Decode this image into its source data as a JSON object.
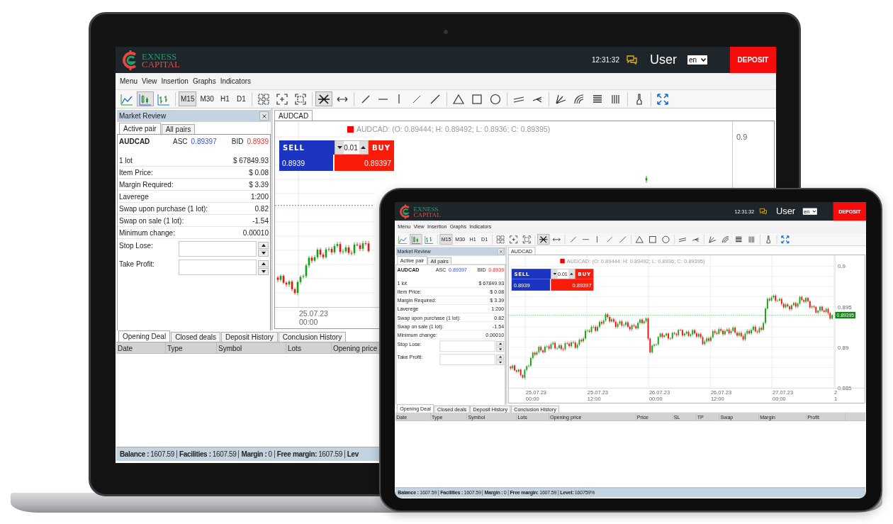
{
  "laptop_screen": {
    "header": {
      "logo": {
        "line_1": "EXNESS",
        "line_2": "CAPITAL"
      },
      "time": "12:31:32",
      "user": "User",
      "language": "en",
      "deposit_button": "DEPOSIT"
    },
    "menu": [
      "Menu",
      "View",
      "Insertion",
      "Graphs",
      "Indicators"
    ],
    "toolbar": {
      "chart_types": [
        {
          "kind": "line-chart",
          "selected": false
        },
        {
          "kind": "candlestick-chart",
          "selected": true
        },
        {
          "kind": "bar-chart",
          "selected": false
        }
      ],
      "timeframes": [
        {
          "label": "M15",
          "selected": true
        },
        {
          "label": "M30",
          "selected": false
        },
        {
          "label": "H1",
          "selected": false
        },
        {
          "label": "D1",
          "selected": false
        }
      ],
      "tool_groups": [
        {
          "tools": [
            {
              "kind": "grid-zoom",
              "selected": false
            },
            {
              "kind": "zoom-in",
              "selected": false
            },
            {
              "kind": "zoom-fit",
              "selected": false
            }
          ]
        },
        {
          "tools": [
            {
              "kind": "crosshair",
              "selected": true
            },
            {
              "kind": "horizontal-arrow",
              "selected": false
            }
          ]
        },
        {
          "tools": [
            {
              "kind": "diagonal-line",
              "selected": false
            },
            {
              "kind": "horizontal-line",
              "selected": false
            },
            {
              "kind": "vertical-line",
              "selected": false
            },
            {
              "kind": "diagonal-ray",
              "selected": false
            },
            {
              "kind": "diagonal-segment",
              "selected": false
            }
          ]
        },
        {
          "tools": [
            {
              "kind": "triangle",
              "selected": false
            },
            {
              "kind": "rectangle",
              "selected": false
            },
            {
              "kind": "circle",
              "selected": false
            }
          ]
        },
        {
          "tools": [
            {
              "kind": "parallel-lines",
              "selected": false
            },
            {
              "kind": "pitchfork",
              "selected": false
            }
          ]
        },
        {
          "tools": [
            {
              "kind": "fan-lines",
              "selected": false
            },
            {
              "kind": "arcs",
              "selected": false
            },
            {
              "kind": "horizontal-bars",
              "selected": false
            },
            {
              "kind": "vertical-bars",
              "selected": false
            }
          ]
        },
        {
          "tools": [
            {
              "kind": "brush",
              "selected": false
            }
          ]
        },
        {
          "tools": [
            {
              "kind": "expand",
              "selected": false
            }
          ]
        }
      ]
    },
    "market_review": {
      "title": "Market Review",
      "tabs": [
        {
          "label": "Active pair",
          "selected": true
        },
        {
          "label": "All pairs",
          "selected": false
        }
      ],
      "pair": {
        "symbol": "AUDCAD",
        "ask_label": "ASC",
        "ask": "0.89397",
        "bid_label": "BID",
        "bid": "0.8939"
      },
      "rows": [
        {
          "label": "1 lot",
          "value": "$ 67849.93"
        },
        {
          "label": "Item Price:",
          "value": "$ 0.08"
        },
        {
          "label": "Margin Required:",
          "value": "$ 3.39"
        },
        {
          "label": "Laverege",
          "value": "1:200"
        },
        {
          "label": "Swap upon purchase (1 lot):",
          "value": "0.82"
        },
        {
          "label": "Swap on sale (1 lot):",
          "value": "-1.54"
        },
        {
          "label": "Minimum change:",
          "value": "0.00010"
        }
      ],
      "fields": [
        {
          "label": "Stop Lose:"
        },
        {
          "label": "Take Profit:"
        }
      ]
    },
    "chart": {
      "tab": "AUDCAD",
      "title": "AUDCAD: (O: 0.89444; H: 0.89492; L: 0.8936; C: 0.89395)",
      "trade": {
        "sell_label": "SELL",
        "amount": "0.01",
        "buy_label": "BUY",
        "sell_price": "0.8939",
        "buy_price": "0.89397"
      },
      "y_ticks": [
        "0.9"
      ],
      "x_labels": [
        {
          "date": "25.07.23",
          "time": "00:00"
        }
      ]
    },
    "bottom": {
      "tabs": [
        {
          "label": "Opening Deal",
          "selected": true
        },
        {
          "label": "Closed deals",
          "selected": false
        },
        {
          "label": "Deposit History",
          "selected": false
        },
        {
          "label": "Conclusion History",
          "selected": false
        }
      ],
      "columns": [
        "Date",
        "Type",
        "Symbol",
        "Lots",
        "Opening price"
      ]
    },
    "status_bar": [
      {
        "label": "Balance :",
        "value": "1607.59"
      },
      {
        "label": "Facilities :",
        "value": "1607.59"
      },
      {
        "label": "Margin :",
        "value": "0"
      },
      {
        "label": "Free margin:",
        "value": "1607.59"
      },
      {
        "label": "Lev"
      }
    ]
  },
  "tablet_screen": {
    "header": {
      "logo": {
        "line_1": "EXNESS",
        "line_2": "CAPITAL"
      },
      "time": "12:31:32",
      "user": "User",
      "language": "en",
      "deposit_button": "DEPOSIT"
    },
    "menu": [
      "Menu",
      "View",
      "Insertion",
      "Graphs",
      "Indicators"
    ],
    "toolbar": {
      "chart_types": [
        {
          "kind": "line-chart",
          "selected": false
        },
        {
          "kind": "candlestick-chart",
          "selected": true
        },
        {
          "kind": "bar-chart",
          "selected": false
        }
      ],
      "timeframes": [
        {
          "label": "M15",
          "selected": true
        },
        {
          "label": "M30",
          "selected": false
        },
        {
          "label": "H1",
          "selected": false
        },
        {
          "label": "D1",
          "selected": false
        }
      ],
      "tool_groups": [
        {
          "tools": [
            {
              "kind": "grid-zoom",
              "selected": false
            },
            {
              "kind": "zoom-in",
              "selected": false
            },
            {
              "kind": "zoom-fit",
              "selected": false
            }
          ]
        },
        {
          "tools": [
            {
              "kind": "crosshair",
              "selected": true
            },
            {
              "kind": "horizontal-arrow",
              "selected": false
            }
          ]
        },
        {
          "tools": [
            {
              "kind": "diagonal-line",
              "selected": false
            },
            {
              "kind": "horizontal-line",
              "selected": false
            },
            {
              "kind": "vertical-line",
              "selected": false
            },
            {
              "kind": "diagonal-ray",
              "selected": false
            },
            {
              "kind": "diagonal-segment",
              "selected": false
            }
          ]
        },
        {
          "tools": [
            {
              "kind": "triangle",
              "selected": false
            },
            {
              "kind": "rectangle",
              "selected": false
            },
            {
              "kind": "circle",
              "selected": false
            }
          ]
        },
        {
          "tools": [
            {
              "kind": "parallel-lines",
              "selected": false
            },
            {
              "kind": "pitchfork",
              "selected": false
            }
          ]
        },
        {
          "tools": [
            {
              "kind": "fan-lines",
              "selected": false
            },
            {
              "kind": "arcs",
              "selected": false
            },
            {
              "kind": "horizontal-bars",
              "selected": false
            },
            {
              "kind": "vertical-bars",
              "selected": false
            }
          ]
        },
        {
          "tools": [
            {
              "kind": "brush",
              "selected": false
            }
          ]
        },
        {
          "tools": [
            {
              "kind": "expand",
              "selected": false
            }
          ]
        }
      ]
    },
    "market_review": {
      "title": "Market Review",
      "tabs": [
        {
          "label": "Active pair",
          "selected": true
        },
        {
          "label": "All pairs",
          "selected": false
        }
      ],
      "pair": {
        "symbol": "AUDCAD",
        "ask_label": "ASC",
        "ask": "0.89397",
        "bid_label": "BID",
        "bid": "0.8939"
      },
      "rows": [
        {
          "label": "1 lot",
          "value": "$ 67849.93"
        },
        {
          "label": "Item Price:",
          "value": "$ 0.08"
        },
        {
          "label": "Margin Required:",
          "value": "$ 3.39"
        },
        {
          "label": "Laverege",
          "value": "1:200"
        },
        {
          "label": "Swap upon purchase (1 lot):",
          "value": "0.82"
        },
        {
          "label": "Swap on sale (1 lot):",
          "value": "-1.54"
        },
        {
          "label": "Minimum change:",
          "value": "0.00010"
        }
      ],
      "fields": [
        {
          "label": "Stop Lose:"
        },
        {
          "label": "Take Profit:"
        }
      ]
    },
    "chart": {
      "tab": "AUDCAD",
      "title": "AUDCAD: (O: 0.89444; H: 0.89492; L: 0.8936; C: 0.89395)",
      "trade": {
        "sell_label": "SELL",
        "amount": "0.01",
        "buy_label": "BUY",
        "sell_price": "0.8939",
        "buy_price": "0.89397"
      },
      "y_ticks": [
        "0.9",
        "0.895",
        "0.89",
        "0.885"
      ],
      "x_labels": [
        {
          "date": "25.07.23",
          "time": "00:00"
        },
        {
          "date": "25.07.23",
          "time": "12:00"
        },
        {
          "date": "26.07.23",
          "time": "00:00"
        },
        {
          "date": "26.07.23",
          "time": "12:00"
        },
        {
          "date": "27.07.23",
          "time": "00:00"
        },
        {
          "date": "2",
          "time": "1"
        }
      ],
      "price_marker": "0.89395"
    },
    "bottom": {
      "tabs": [
        {
          "label": "Opening Deal",
          "selected": true
        },
        {
          "label": "Closed deals",
          "selected": false
        },
        {
          "label": "Deposit History",
          "selected": false
        },
        {
          "label": "Conclusion History",
          "selected": false
        }
      ],
      "columns": [
        "Date",
        "Type",
        "Symbol",
        "Lots",
        "Opening price",
        "Price",
        "SL",
        "TP",
        "Swap",
        "Margin",
        "Profit"
      ]
    },
    "status_bar": [
      {
        "label": "Balance :",
        "value": "1607.59"
      },
      {
        "label": "Facilities :",
        "value": "1607.59"
      },
      {
        "label": "Margin :",
        "value": "0"
      },
      {
        "label": "Free margin:",
        "value": "1607.59"
      },
      {
        "label": "Level:",
        "value": "160759%"
      }
    ]
  }
}
